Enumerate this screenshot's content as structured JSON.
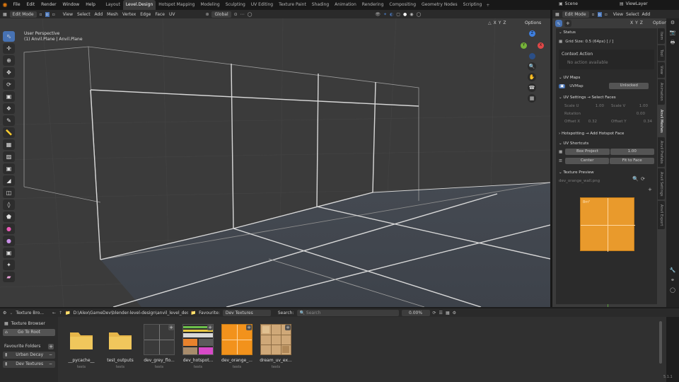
{
  "topbar": {
    "menus": [
      "File",
      "Edit",
      "Render",
      "Window",
      "Help"
    ],
    "workspaces": [
      {
        "label": "Layout",
        "active": false
      },
      {
        "label": "Level.Design",
        "active": true
      },
      {
        "label": "Hotspot Mapping",
        "active": false
      },
      {
        "label": "Modeling",
        "active": false
      },
      {
        "label": "Sculpting",
        "active": false
      },
      {
        "label": "UV Editing",
        "active": false
      },
      {
        "label": "Texture Paint",
        "active": false
      },
      {
        "label": "Shading",
        "active": false
      },
      {
        "label": "Animation",
        "active": false
      },
      {
        "label": "Rendering",
        "active": false
      },
      {
        "label": "Compositing",
        "active": false
      },
      {
        "label": "Geometry Nodes",
        "active": false
      },
      {
        "label": "Scripting",
        "active": false
      }
    ],
    "scene": "Scene",
    "view_layer": "ViewLayer"
  },
  "viewport": {
    "mode": "Edit Mode",
    "menus": [
      "View",
      "Select",
      "Add",
      "Mesh",
      "Vertex",
      "Edge",
      "Face",
      "UV"
    ],
    "transform": "Global",
    "overlay_title": "User Perspective",
    "overlay_object": "(1) Anvil.Plane | Anvil.Plane",
    "options": "Options",
    "axis_labels": [
      "X",
      "Y",
      "Z"
    ],
    "gizmo": {
      "z": "Z",
      "y": "Y",
      "x": "X"
    }
  },
  "right_editor": {
    "mode": "Edit Mode",
    "menus": [
      "View",
      "Select",
      "Add"
    ],
    "options": "Options",
    "axis_labels": [
      "X",
      "Y",
      "Z"
    ]
  },
  "panel": {
    "status": {
      "title": "Status",
      "grid_size": "Grid Size: 0.5  (64px)  [ / ]"
    },
    "context": {
      "title": "Context Action",
      "text": "No action available"
    },
    "uvmaps": {
      "title": "UV Maps",
      "map": "UVMap",
      "lock": "Unlocked"
    },
    "uvsettings": {
      "title": "UV Settings  → Select Faces",
      "scale_u_label": "Scale U",
      "scale_u": "1.00",
      "scale_v_label": "Scale V",
      "scale_v": "1.00",
      "rotation_label": "Rotation",
      "rotation": "0.00",
      "offset_x_label": "Offset X",
      "offset_x": "0.32",
      "offset_y_label": "Offset Y",
      "offset_y": "0.34"
    },
    "hotspotting": {
      "title": "Hotspotting  → Add Hotspot Face"
    },
    "shortcuts": {
      "title": "UV Shortcuts",
      "box_project": "Box Project",
      "box_value": "1.00",
      "center": "Center",
      "fit": "Fit to Face"
    },
    "preview": {
      "title": "Texture Preview",
      "file": "dev_orange_wall.png",
      "tex_text": "8m²"
    },
    "tabs": [
      "Item",
      "Tool",
      "View",
      "Animation",
      "Anvil Meshes",
      "Anvil Prefabs",
      "Anvil Settings",
      "Anvil Export"
    ],
    "active_tab": "Anvil Meshes"
  },
  "browser": {
    "editor": "Texture Bro...",
    "path": "D:\\Alex\\GameDev\\blender-level-design\\anvil_level_design\\...",
    "favourite_label": "Favourite:",
    "favourite": "Dev Textures",
    "search_label": "Search:",
    "search_placeholder": "Search",
    "zoom": "0.00%",
    "sidebar": {
      "title": "Texture Browser",
      "go_root": "Go To Root",
      "fav_title": "Favourite Folders",
      "folders": [
        "Urban Decay",
        "Dev Textures"
      ]
    },
    "items": [
      {
        "name": "__pycache__",
        "sub": "tests"
      },
      {
        "name": "test_outputs",
        "sub": "tests"
      },
      {
        "name": "dev_grey_flo...",
        "sub": "tests"
      },
      {
        "name": "dev_hotspot...",
        "sub": "tests"
      },
      {
        "name": "dev_orange_...",
        "sub": "tests"
      },
      {
        "name": "dream_uv_ex...",
        "sub": "tests"
      }
    ],
    "version": "5.1.1"
  }
}
